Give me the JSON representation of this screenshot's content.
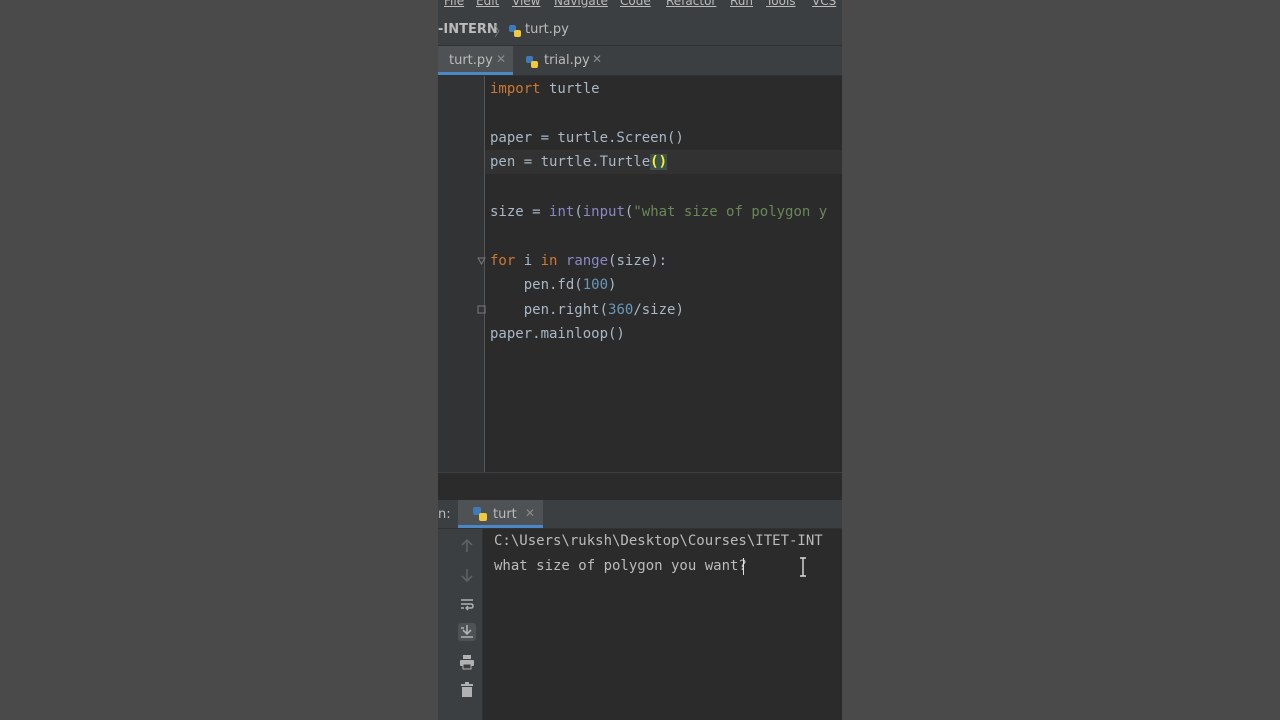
{
  "menu": [
    "File",
    "Edit",
    "View",
    "Navigate",
    "Code",
    "Refactor",
    "Run",
    "Tools",
    "VCS"
  ],
  "breadcrumb": {
    "project": "-INTERN",
    "file": "turt.py"
  },
  "tabs": [
    {
      "label": "turt.py",
      "active": true
    },
    {
      "label": "trial.py",
      "active": false
    }
  ],
  "code": {
    "l1_kw": "import",
    "l1_rest": " turtle",
    "l3": "paper = turtle.Screen()",
    "l4_a": "pen = turtle.Turtle",
    "l4_b": "()",
    "l6_a": "size = ",
    "l6_int": "int",
    "l6_b": "(",
    "l6_input": "input",
    "l6_c": "(",
    "l6_str": "\"what size of polygon y",
    "l8_for": "for",
    "l8_a": " i ",
    "l8_in": "in",
    "l8_b": " ",
    "l8_range": "range",
    "l8_c": "(size):",
    "l9_a": "    pen.fd(",
    "l9_num": "100",
    "l9_b": ")",
    "l10_a": "    pen.right(",
    "l10_num": "360",
    "l10_b": "/size)",
    "l11": "paper.mainloop()"
  },
  "run": {
    "label": "n:",
    "tab": "turt",
    "path": "C:\\Users\\ruksh\\Desktop\\Courses\\ITET-INT",
    "prompt": "what size of polygon you want?"
  },
  "colors": {
    "keyword": "#cc7832",
    "number": "#6897bb",
    "string": "#6a8759",
    "builtin": "#8888c6",
    "accent": "#4a88c7"
  },
  "icons": [
    "python-file-icon",
    "close-icon",
    "up-arrow-icon",
    "down-arrow-icon",
    "soft-wrap-icon",
    "scroll-to-end-icon",
    "print-icon",
    "trash-icon"
  ]
}
